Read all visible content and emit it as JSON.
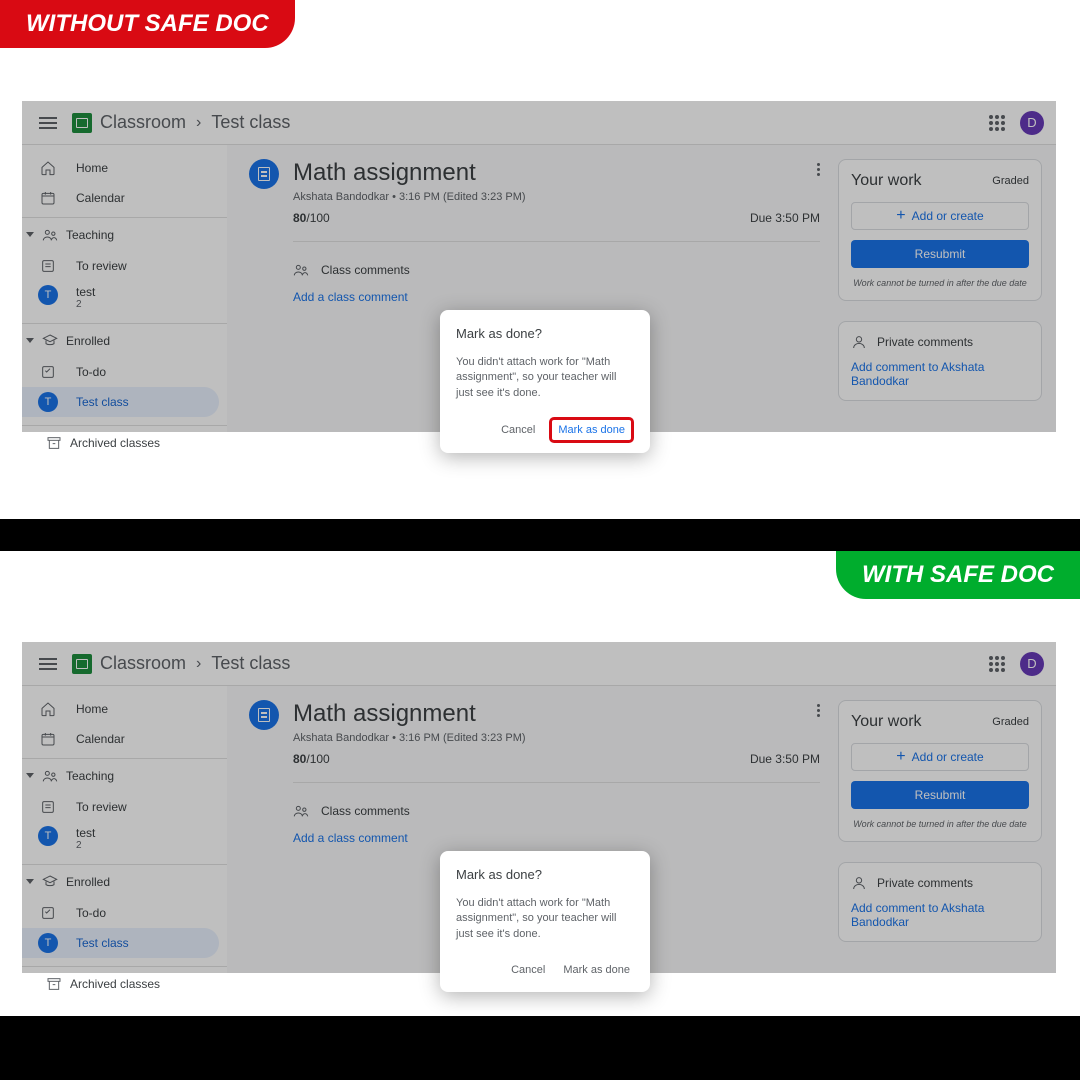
{
  "banners": {
    "without": "WITHOUT SAFE DOC",
    "with": "WITH SAFE DOC"
  },
  "header": {
    "app": "Classroom",
    "crumb": "Test class",
    "avatar_letter": "D"
  },
  "sidebar": {
    "home": "Home",
    "calendar": "Calendar",
    "teaching": "Teaching",
    "to_review": "To review",
    "class_item": {
      "letter": "T",
      "name": "test",
      "count": "2"
    },
    "enrolled": "Enrolled",
    "todo": "To-do",
    "enrolled_item": {
      "letter": "T",
      "name": "Test class"
    },
    "archived": "Archived classes"
  },
  "assignment": {
    "title": "Math assignment",
    "author": "Akshata Bandodkar",
    "time": "3:16 PM (Edited 3:23 PM)",
    "score": "80",
    "score_total": "/100",
    "due": "Due 3:50 PM",
    "class_comments": "Class comments",
    "add_comment": "Add a class comment"
  },
  "work": {
    "title": "Your work",
    "status": "Graded",
    "add_create": "Add or create",
    "resubmit": "Resubmit",
    "note": "Work cannot be turned in after the due date"
  },
  "private": {
    "title": "Private comments",
    "link": "Add comment to Akshata Bandodkar"
  },
  "dialog": {
    "title": "Mark as done?",
    "body": "You didn't attach work for \"Math assignment\", so your teacher will just see it's done.",
    "cancel": "Cancel",
    "confirm": "Mark as done"
  }
}
